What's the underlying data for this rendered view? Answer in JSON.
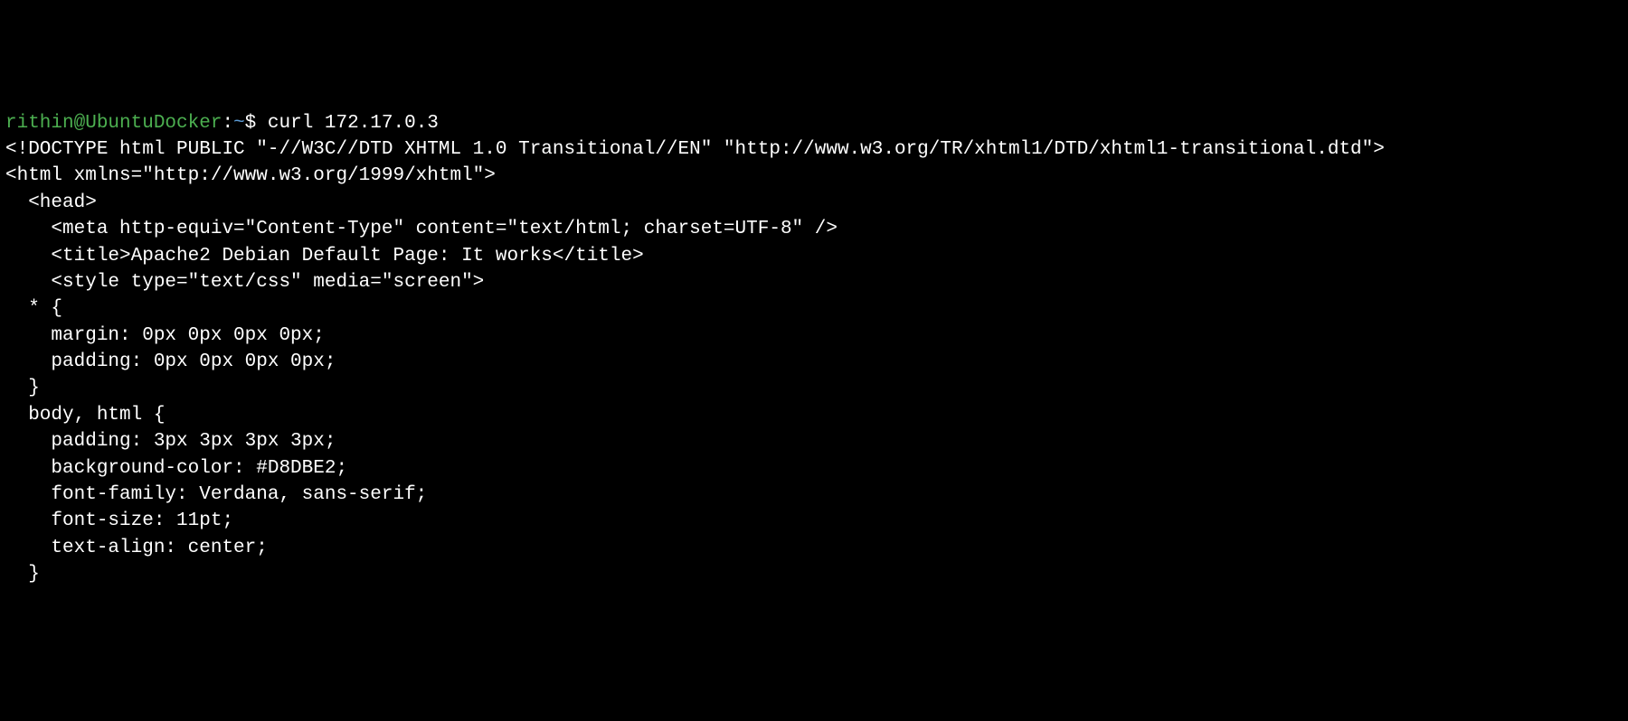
{
  "terminal": {
    "prompt": {
      "user_host": "rithin@UbuntuDocker",
      "separator": ":",
      "path": "~",
      "symbol": "$"
    },
    "command": " curl 172.17.0.3",
    "output_lines": [
      "",
      "<!DOCTYPE html PUBLIC \"-//W3C//DTD XHTML 1.0 Transitional//EN\" \"http://www.w3.org/TR/xhtml1/DTD/xhtml1-transitional.dtd\">",
      "<html xmlns=\"http://www.w3.org/1999/xhtml\">",
      "  <head>",
      "    <meta http-equiv=\"Content-Type\" content=\"text/html; charset=UTF-8\" />",
      "    <title>Apache2 Debian Default Page: It works</title>",
      "    <style type=\"text/css\" media=\"screen\">",
      "  * {",
      "    margin: 0px 0px 0px 0px;",
      "    padding: 0px 0px 0px 0px;",
      "  }",
      "",
      "  body, html {",
      "    padding: 3px 3px 3px 3px;",
      "",
      "    background-color: #D8DBE2;",
      "",
      "    font-family: Verdana, sans-serif;",
      "    font-size: 11pt;",
      "    text-align: center;",
      "  }"
    ]
  }
}
